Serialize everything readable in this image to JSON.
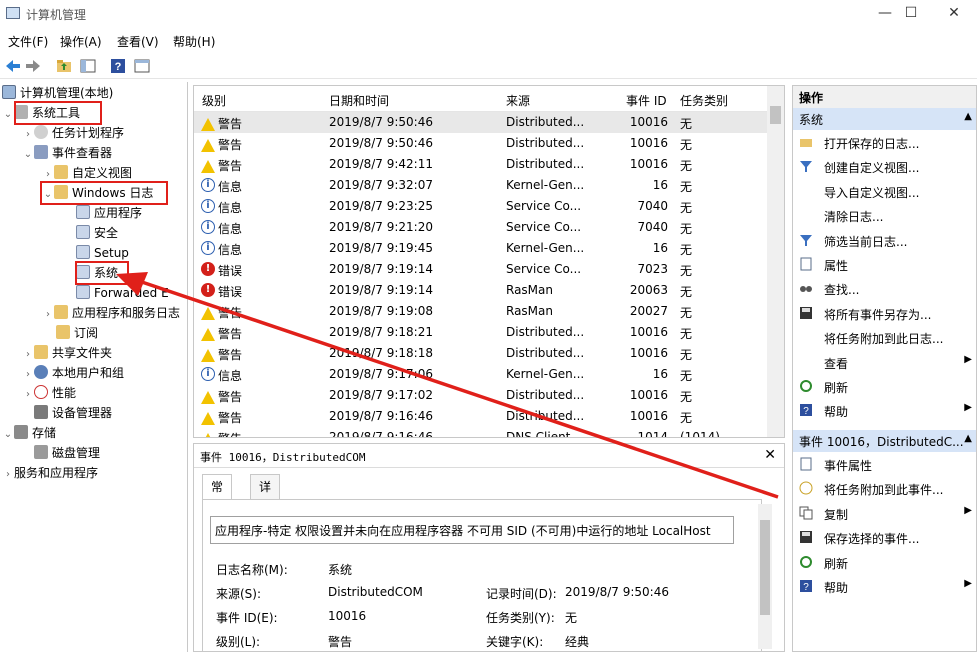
{
  "window": {
    "title": "计算机管理",
    "minimize": "—",
    "maximize": "☐",
    "close": "✕"
  },
  "menu": [
    "文件(F)",
    "操作(A)",
    "查看(V)",
    "帮助(H)"
  ],
  "tree": {
    "root": "计算机管理(本地)",
    "system_tools": "系统工具",
    "task_scheduler": "任务计划程序",
    "event_viewer": "事件查看器",
    "custom_views": "自定义视图",
    "windows_logs": "Windows 日志",
    "application": "应用程序",
    "security": "安全",
    "setup": "Setup",
    "system": "系统",
    "forwarded": "Forwarded E",
    "apps_services": "应用程序和服务日志",
    "subscriptions": "订阅",
    "shared_folders": "共享文件夹",
    "local_users": "本地用户和组",
    "performance": "性能",
    "device_manager": "设备管理器",
    "storage": "存储",
    "disk_management": "磁盘管理",
    "services_apps": "服务和应用程序"
  },
  "grid": {
    "columns": [
      "级别",
      "日期和时间",
      "来源",
      "事件 ID",
      "任务类别"
    ],
    "rows": [
      {
        "level": "警告",
        "type": "warn",
        "time": "2019/8/7 9:50:46",
        "source": "Distributed...",
        "id": "10016",
        "task": "无"
      },
      {
        "level": "警告",
        "type": "warn",
        "time": "2019/8/7 9:50:46",
        "source": "Distributed...",
        "id": "10016",
        "task": "无"
      },
      {
        "level": "警告",
        "type": "warn",
        "time": "2019/8/7 9:42:11",
        "source": "Distributed...",
        "id": "10016",
        "task": "无"
      },
      {
        "level": "信息",
        "type": "info",
        "time": "2019/8/7 9:32:07",
        "source": "Kernel-Gen...",
        "id": "16",
        "task": "无"
      },
      {
        "level": "信息",
        "type": "info",
        "time": "2019/8/7 9:23:25",
        "source": "Service Co...",
        "id": "7040",
        "task": "无"
      },
      {
        "level": "信息",
        "type": "info",
        "time": "2019/8/7 9:21:20",
        "source": "Service Co...",
        "id": "7040",
        "task": "无"
      },
      {
        "level": "信息",
        "type": "info",
        "time": "2019/8/7 9:19:45",
        "source": "Kernel-Gen...",
        "id": "16",
        "task": "无"
      },
      {
        "level": "错误",
        "type": "err",
        "time": "2019/8/7 9:19:14",
        "source": "Service Co...",
        "id": "7023",
        "task": "无"
      },
      {
        "level": "错误",
        "type": "err",
        "time": "2019/8/7 9:19:14",
        "source": "RasMan",
        "id": "20063",
        "task": "无"
      },
      {
        "level": "警告",
        "type": "warn",
        "time": "2019/8/7 9:19:08",
        "source": "RasMan",
        "id": "20027",
        "task": "无"
      },
      {
        "level": "警告",
        "type": "warn",
        "time": "2019/8/7 9:18:21",
        "source": "Distributed...",
        "id": "10016",
        "task": "无"
      },
      {
        "level": "警告",
        "type": "warn",
        "time": "2019/8/7 9:18:18",
        "source": "Distributed...",
        "id": "10016",
        "task": "无"
      },
      {
        "level": "信息",
        "type": "info",
        "time": "2019/8/7 9:17:06",
        "source": "Kernel-Gen...",
        "id": "16",
        "task": "无"
      },
      {
        "level": "警告",
        "type": "warn",
        "time": "2019/8/7 9:17:02",
        "source": "Distributed...",
        "id": "10016",
        "task": "无"
      },
      {
        "level": "警告",
        "type": "warn",
        "time": "2019/8/7 9:16:46",
        "source": "Distributed...",
        "id": "10016",
        "task": "无"
      },
      {
        "level": "警告",
        "type": "warn",
        "time": "2019/8/7 9:16:46",
        "source": "DNS Client...",
        "id": "1014",
        "task": "(1014)"
      }
    ]
  },
  "detail": {
    "title": "事件 10016，DistributedCOM",
    "tab_general": "常规",
    "tab_details": "详细信息",
    "message": "应用程序-特定 权限设置并未向在应用程序容器 不可用 SID (不可用)中运行的地址 LocalHost",
    "log_name_label": "日志名称(M):",
    "log_name": "系统",
    "source_label": "来源(S):",
    "source": "DistributedCOM",
    "logged_label": "记录时间(D):",
    "logged": "2019/8/7 9:50:46",
    "event_id_label": "事件 ID(E):",
    "event_id": "10016",
    "task_label": "任务类别(Y):",
    "task": "无",
    "level_label": "级别(L):",
    "level": "警告",
    "keywords_label": "关键字(K):",
    "keywords": "经典"
  },
  "actions": {
    "header": "操作",
    "section1": "系统",
    "items1": [
      {
        "label": "打开保存的日志...",
        "icon": "folder-open-icon"
      },
      {
        "label": "创建自定义视图...",
        "icon": "filter-icon"
      },
      {
        "label": "导入自定义视图...",
        "icon": ""
      },
      {
        "label": "清除日志...",
        "icon": ""
      },
      {
        "label": "筛选当前日志...",
        "icon": "filter-icon"
      },
      {
        "label": "属性",
        "icon": "properties-icon"
      },
      {
        "label": "查找...",
        "icon": "binoculars-icon"
      },
      {
        "label": "将所有事件另存为...",
        "icon": "save-icon"
      },
      {
        "label": "将任务附加到此日志...",
        "icon": ""
      },
      {
        "label": "查看",
        "icon": "",
        "submenu": true
      },
      {
        "label": "刷新",
        "icon": "refresh-icon"
      },
      {
        "label": "帮助",
        "icon": "help-icon",
        "submenu": true
      }
    ],
    "section2": "事件 10016，DistributedC...",
    "items2": [
      {
        "label": "事件属性",
        "icon": "properties-icon"
      },
      {
        "label": "将任务附加到此事件...",
        "icon": "task-icon"
      },
      {
        "label": "复制",
        "icon": "copy-icon",
        "submenu": true
      },
      {
        "label": "保存选择的事件...",
        "icon": "save-icon"
      },
      {
        "label": "刷新",
        "icon": "refresh-icon"
      },
      {
        "label": "帮助",
        "icon": "help-icon",
        "submenu": true
      }
    ]
  },
  "colors": {
    "highlight_red": "#e0201a",
    "section_blue": "#d6e4f7",
    "warning_yellow": "#f2c200"
  }
}
